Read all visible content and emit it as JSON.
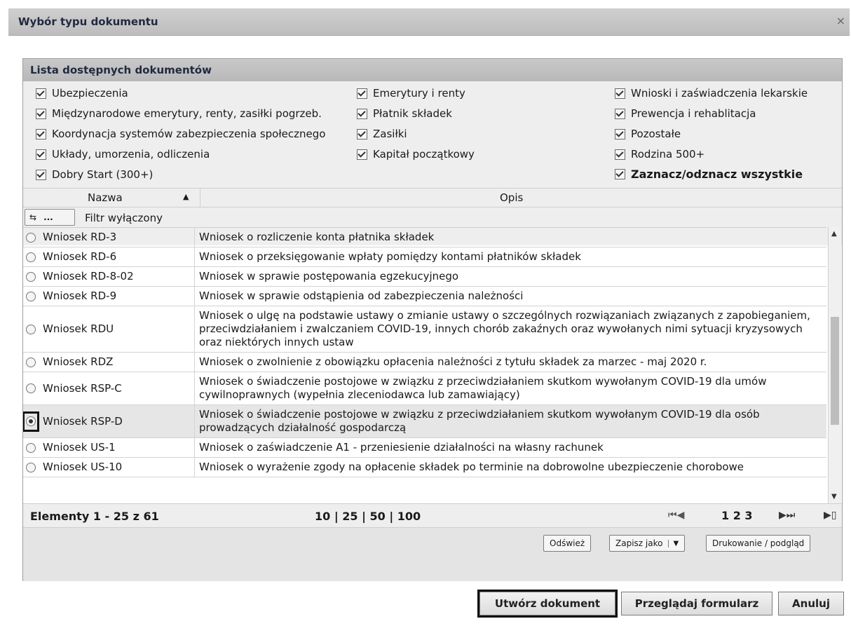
{
  "window": {
    "title": "Wybór typu dokumentu",
    "close": "×"
  },
  "panel": {
    "title": "Lista dostępnych dokumentów"
  },
  "filters": {
    "col1": [
      "Ubezpieczenia",
      "Międzynarodowe emerytury, renty, zasiłki pogrzeb.",
      "Koordynacja systemów zabezpieczenia społecznego",
      "Układy, umorzenia, odliczenia",
      "Dobry Start (300+)"
    ],
    "col2": [
      "Emerytury i renty",
      "Płatnik składek",
      "Zasiłki",
      "Kapitał początkowy"
    ],
    "col3": [
      "Wnioski i zaświadczenia lekarskie",
      "Prewencja i rehablitacja",
      "Pozostałe",
      "Rodzina 500+"
    ],
    "toggle_all": "Zaznacz/odznacz wszystkie"
  },
  "columns": {
    "name": "Nazwa",
    "sort_icon": "▲",
    "desc": "Opis"
  },
  "filter_bar": {
    "button_icon": "⇆",
    "button_dots": "...",
    "status": "Filtr wyłączony"
  },
  "rows": [
    {
      "name": "Wniosek RD-3",
      "desc": "Wniosek o rozliczenie konta płatnika składek",
      "selected": false
    },
    {
      "name": "Wniosek RD-6",
      "desc": "Wniosek o przeksięgowanie wpłaty pomiędzy kontami płatników składek",
      "selected": false
    },
    {
      "name": "Wniosek RD-8-02",
      "desc": "Wniosek w sprawie postępowania egzekucyjnego",
      "selected": false
    },
    {
      "name": "Wniosek RD-9",
      "desc": "Wniosek w sprawie odstąpienia od zabezpieczenia należności",
      "selected": false
    },
    {
      "name": "Wniosek RDU",
      "desc": "Wniosek o ulgę na podstawie ustawy o zmianie ustawy o szczególnych rozwiązaniach związanych z zapobieganiem, przeciwdziałaniem i zwalczaniem COVID-19, innych chorób zakaźnych oraz wywołanych nimi sytuacji kryzysowych oraz niektórych innych ustaw",
      "selected": false
    },
    {
      "name": "Wniosek RDZ",
      "desc": "Wniosek o zwolnienie z obowiązku opłacenia należności z tytułu składek za marzec - maj 2020 r.",
      "selected": false
    },
    {
      "name": "Wniosek RSP-C",
      "desc": "Wniosek o świadczenie postojowe w związku z przeciwdziałaniem skutkom wywołanym COVID-19 dla umów cywilnoprawnych (wypełnia zleceniodawca lub zamawiający)",
      "selected": false
    },
    {
      "name": "Wniosek RSP-D",
      "desc": "Wniosek o świadczenie postojowe w związku z przeciwdziałaniem skutkom wywołanym COVID-19 dla osób prowadzących działalność gospodarczą",
      "selected": true
    },
    {
      "name": "Wniosek US-1",
      "desc": "Wniosek o zaświadczenie A1 - przeniesienie działalności na własny rachunek",
      "selected": false
    },
    {
      "name": "Wniosek US-10",
      "desc": "Wniosek o wyrażenie zgody na opłacenie składek po terminie na dobrowolne ubezpieczenie chorobowe",
      "selected": false
    }
  ],
  "pager": {
    "count": "Elementy 1 - 25 z 61",
    "sizes": "10 | 25 | 50 | 100",
    "nav_first": "⏮◀",
    "pages": "1 2 3",
    "nav_last": "▶⏭",
    "extra": "▶▯"
  },
  "toolbar": {
    "refresh": "Odśwież",
    "save_as": "Zapisz jako",
    "save_as_arrow": "▼",
    "print": "Drukowanie / podgląd"
  },
  "actions": {
    "create": "Utwórz dokument",
    "browse": "Przeglądaj formularz",
    "cancel": "Anuluj"
  }
}
